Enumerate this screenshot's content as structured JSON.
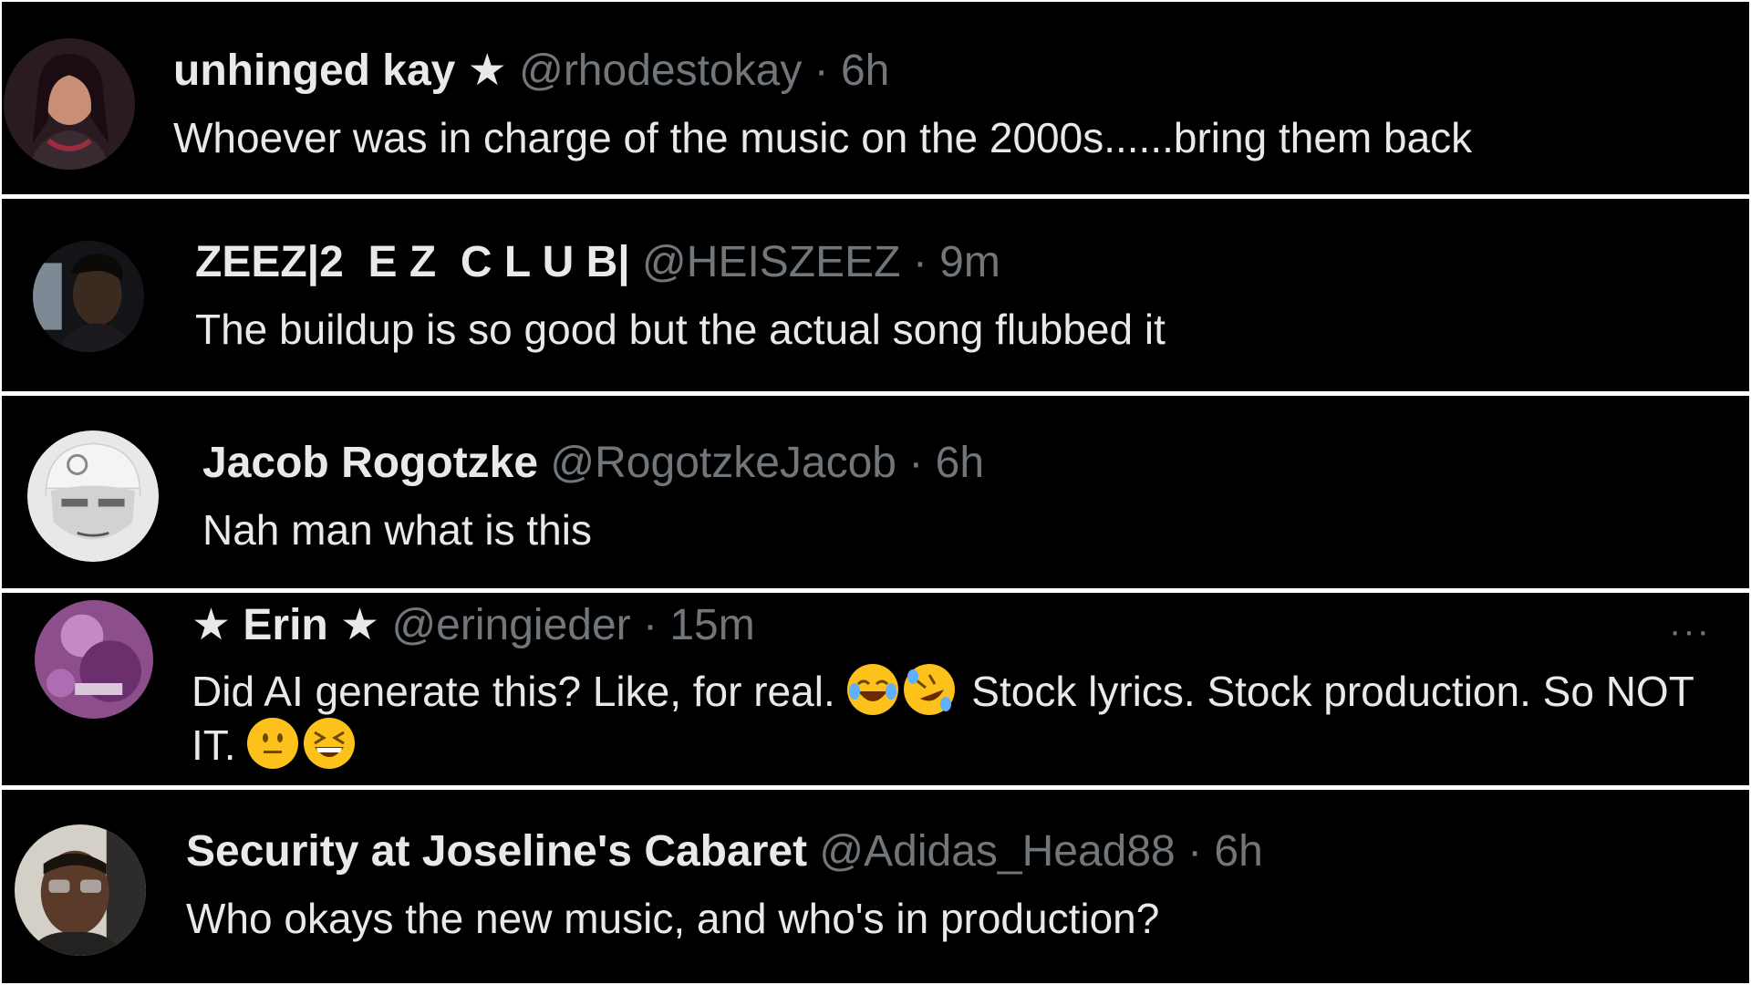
{
  "tweets": [
    {
      "name": "unhinged kay ★",
      "handle": "@rhodestokay",
      "separator": "·",
      "time": "6h",
      "text": "Whoever was in charge of the music on the 2000s......bring them back"
    },
    {
      "name": "ZEEZ|2  E Z  C L U B|",
      "handle": "@HEISZEEZ",
      "separator": "·",
      "time": "9m",
      "text": "The buildup is so good but the actual song flubbed it"
    },
    {
      "name": "Jacob Rogotzke",
      "handle": "@RogotzkeJacob",
      "separator": "·",
      "time": "6h",
      "text": "Nah man what is this"
    },
    {
      "name": "★ Erin ★",
      "handle": "@eringieder",
      "separator": "·",
      "time": "15m",
      "text_part1": "Did AI generate this? Like, for real.",
      "text_part2": "Stock lyrics. Stock production. So NOT IT.",
      "more": "···"
    },
    {
      "name": "Security at Joseline's Cabaret",
      "handle": "@Adidas_Head88",
      "separator": "·",
      "time": "6h",
      "text": "Who okays the new music, and who's in production?"
    }
  ],
  "icons": {
    "emoji_1": "face-with-tears-of-joy-icon",
    "emoji_2": "rolling-on-floor-laughing-icon",
    "emoji_3": "neutral-face-icon",
    "emoji_4": "grinning-squinting-face-icon",
    "more": "more-options-icon"
  },
  "colors": {
    "background": "#000000",
    "text": "#e7e9ea",
    "secondary": "#71767b",
    "divider": "#ffffff"
  }
}
